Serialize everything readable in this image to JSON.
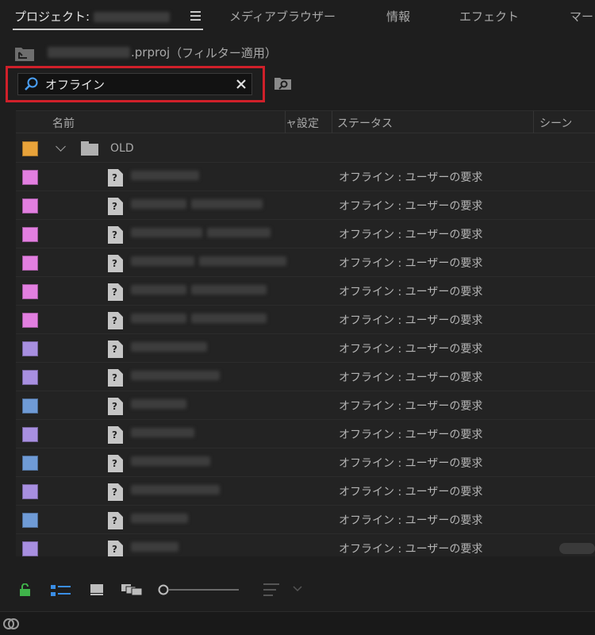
{
  "tabs": [
    {
      "label": "プロジェクト: ",
      "active": true
    },
    {
      "label": "メディアブラウザー",
      "active": false
    },
    {
      "label": "情報",
      "active": false
    },
    {
      "label": "エフェクト",
      "active": false
    },
    {
      "label": "マー",
      "active": false
    }
  ],
  "project": {
    "file_suffix": ".prproj",
    "filter_note": "（フィルター適用）"
  },
  "search": {
    "value": "オフライン"
  },
  "columns": {
    "name": "名前",
    "frame_rate": "ャ設定",
    "status": "ステータス",
    "scene": "シーン"
  },
  "folder": {
    "name": "OLD",
    "label_color": "#e8a33a"
  },
  "rows": [
    {
      "label_color": "#e27fe0",
      "status": "オフライン : ユーザーの要求"
    },
    {
      "label_color": "#e27fe0",
      "status": "オフライン : ユーザーの要求"
    },
    {
      "label_color": "#e27fe0",
      "status": "オフライン : ユーザーの要求"
    },
    {
      "label_color": "#e27fe0",
      "status": "オフライン : ユーザーの要求"
    },
    {
      "label_color": "#e27fe0",
      "status": "オフライン : ユーザーの要求"
    },
    {
      "label_color": "#e27fe0",
      "status": "オフライン : ユーザーの要求"
    },
    {
      "label_color": "#a88fe0",
      "status": "オフライン : ユーザーの要求"
    },
    {
      "label_color": "#a88fe0",
      "status": "オフライン : ユーザーの要求"
    },
    {
      "label_color": "#6f9bd6",
      "status": "オフライン : ユーザーの要求"
    },
    {
      "label_color": "#a88fe0",
      "status": "オフライン : ユーザーの要求"
    },
    {
      "label_color": "#6f9bd6",
      "status": "オフライン : ユーザーの要求"
    },
    {
      "label_color": "#a88fe0",
      "status": "オフライン : ユーザーの要求"
    },
    {
      "label_color": "#6f9bd6",
      "status": "オフライン : ユーザーの要求"
    },
    {
      "label_color": "#a88fe0",
      "status": "オフライン : ユーザーの要求"
    }
  ],
  "colors": {
    "highlight_border": "#d0202a",
    "lock_green": "#3fb34a",
    "list_view_blue": "#3a8ee6"
  }
}
